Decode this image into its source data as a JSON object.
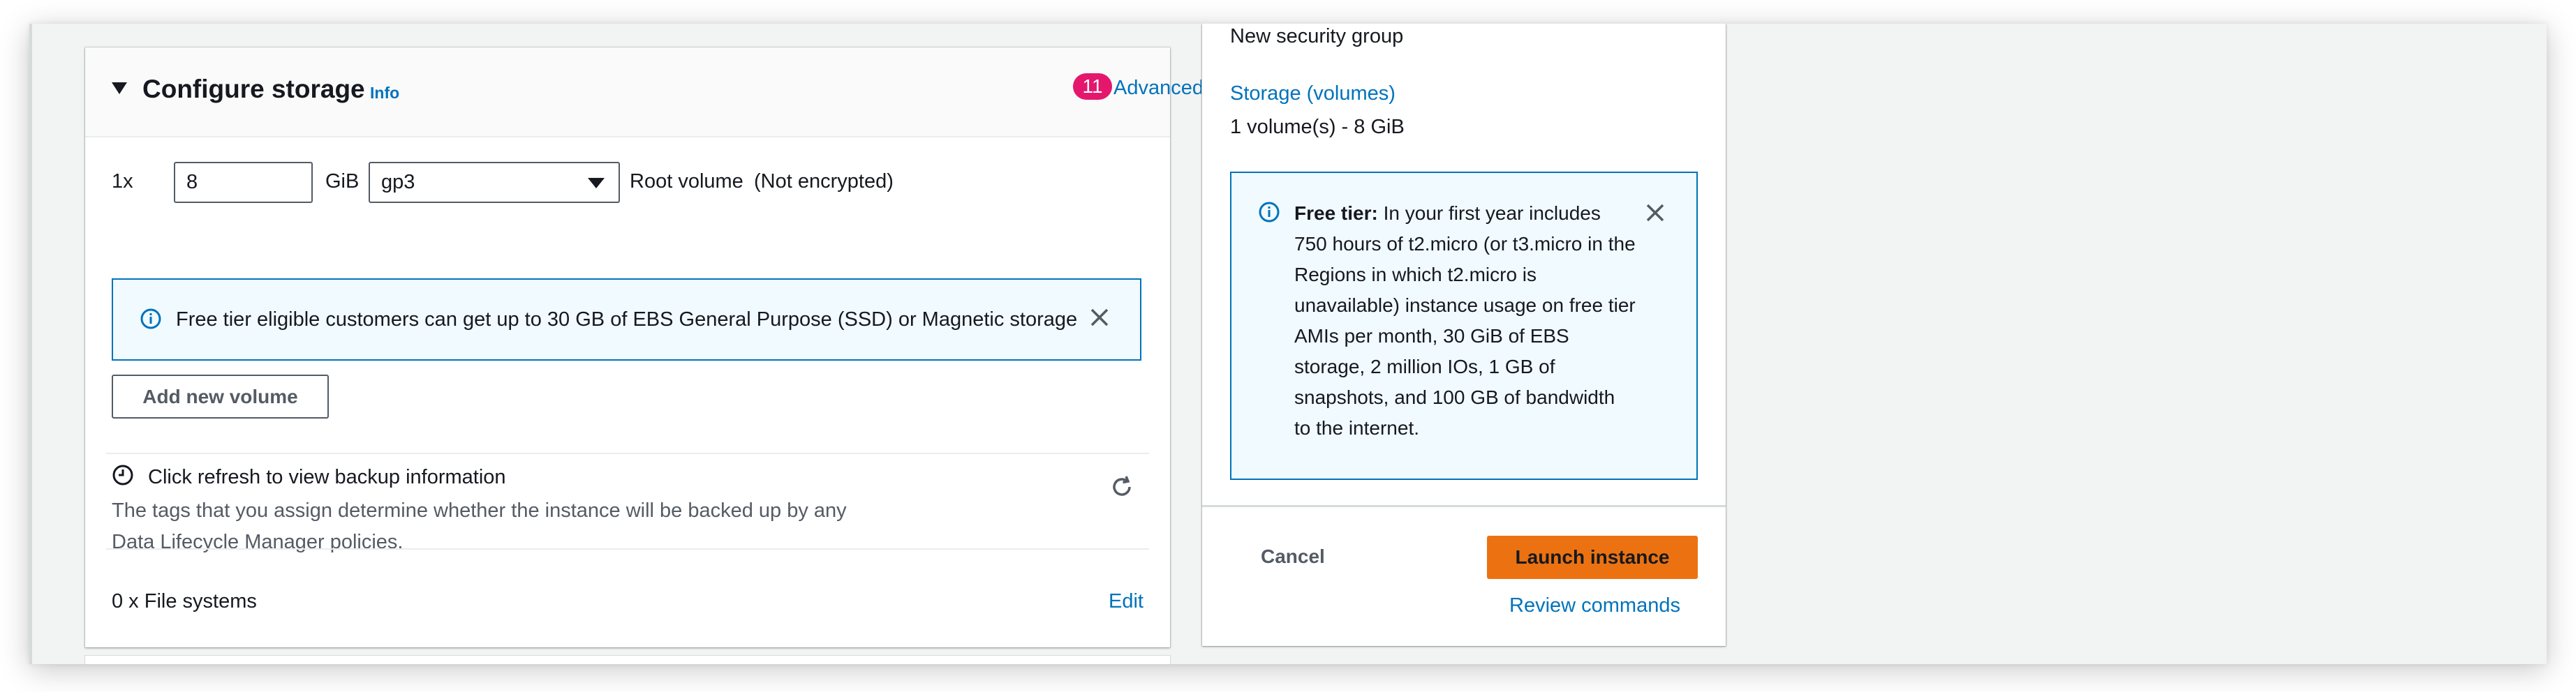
{
  "storage": {
    "title": "Configure storage",
    "info_label": "Info",
    "advanced_count": "11",
    "advanced_label": "Advanced",
    "volume_count_label": "1x",
    "size_value": "8",
    "size_unit": "GiB",
    "volume_type": "gp3",
    "root_volume_label": "Root volume",
    "encryption_label": "(Not encrypted)",
    "free_tier_alert": "Free tier eligible customers can get up to 30 GB of EBS General Purpose (SSD) or Magnetic storage",
    "add_volume_label": "Add new volume",
    "backup_title": "Click refresh to view backup information",
    "backup_desc": "The tags that you assign determine whether the instance will be backed up by any Data Lifecycle Manager policies.",
    "file_systems_label": "0 x File systems",
    "edit_label": "Edit"
  },
  "summary": {
    "security_group_value": "New security group",
    "storage_link": "Storage (volumes)",
    "storage_value": "1 volume(s) - 8 GiB",
    "free_tier_heading": "Free tier:",
    "free_tier_body": "In your first year includes 750 hours of t2.micro (or t3.micro in the Regions in which t2.micro is unavailable) instance usage on free tier AMIs per month, 30 GiB of EBS storage, 2 million IOs, 1 GB of snapshots, and 100 GB of bandwidth to the internet.",
    "cancel_label": "Cancel",
    "launch_label": "Launch instance",
    "review_label": "Review commands"
  },
  "colors": {
    "link": "#0073bb",
    "primary_button": "#ec7211",
    "badge": "#e4176d",
    "info_background": "#f1faff"
  },
  "icons": [
    "caret-down-icon",
    "info-icon",
    "close-icon",
    "clock-icon",
    "refresh-icon",
    "select-caret-icon"
  ]
}
